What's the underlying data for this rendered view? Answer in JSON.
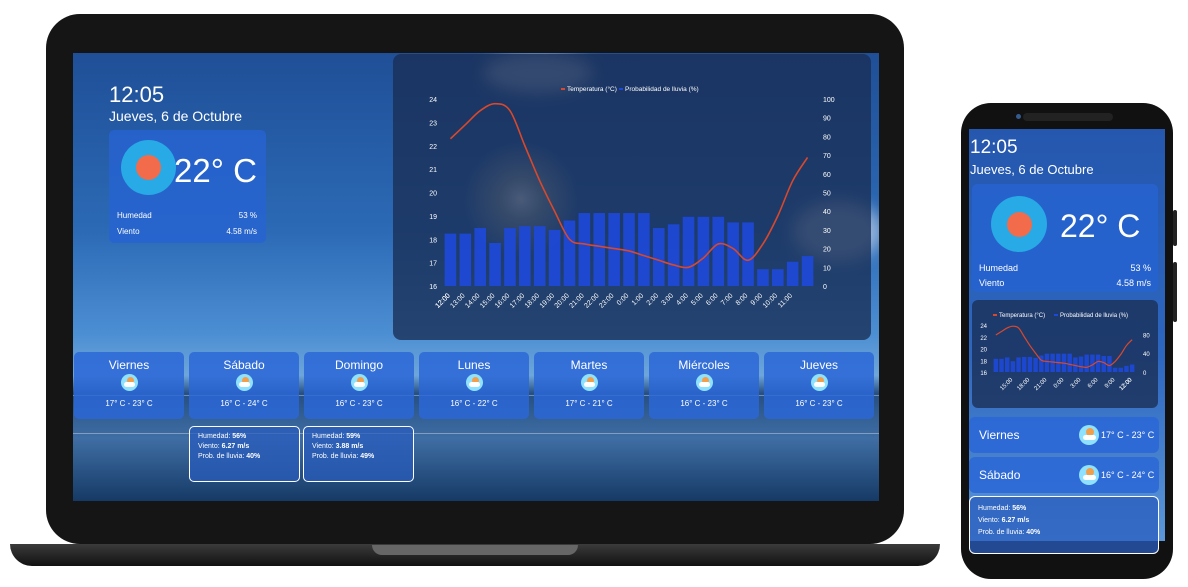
{
  "current": {
    "time": "12:05",
    "date": "Jueves, 6 de Octubre",
    "temperature": "22° C",
    "humidity_label": "Humedad",
    "humidity_value": "53 %",
    "wind_label": "Viento",
    "wind_value": "4.58 m/s"
  },
  "chart_data": {
    "type": "line",
    "legend": [
      "Temperatura (°C)",
      "Probabilidad de lluvia (%)"
    ],
    "legend_position": "top",
    "x": [
      "12:00",
      "13:00",
      "14:00",
      "15:00",
      "16:00",
      "17:00",
      "18:00",
      "19:00",
      "20:00",
      "21:00",
      "22:00",
      "23:00",
      "0:00",
      "1:00",
      "2:00",
      "3:00",
      "4:00",
      "5:00",
      "6:00",
      "7:00",
      "8:00",
      "9:00",
      "10:00",
      "11:00",
      "12:00"
    ],
    "series": [
      {
        "name": "Temperatura (°C)",
        "type": "line",
        "axis": "left",
        "color": "#d9482b",
        "values": [
          22.3,
          22.9,
          23.5,
          23.8,
          23.5,
          22.0,
          20.5,
          19.2,
          18.0,
          17.8,
          17.7,
          17.6,
          17.5,
          17.3,
          17.1,
          16.9,
          16.8,
          17.2,
          17.8,
          17.6,
          17.1,
          17.8,
          19.0,
          20.5,
          21.5
        ]
      },
      {
        "name": "Probabilidad de lluvia (%)",
        "type": "bar",
        "axis": "right",
        "color": "#1d49d8",
        "values": [
          28,
          28,
          31,
          23,
          31,
          32,
          32,
          30,
          35,
          39,
          39,
          39,
          39,
          39,
          31,
          33,
          37,
          37,
          37,
          34,
          34,
          9,
          9,
          13,
          16
        ]
      }
    ],
    "y_left": {
      "min": 16,
      "max": 24,
      "ticks": [
        16,
        17,
        18,
        19,
        20,
        21,
        22,
        23,
        24
      ]
    },
    "y_right": {
      "min": 0,
      "max": 100,
      "ticks": [
        0,
        10,
        20,
        30,
        40,
        50,
        60,
        70,
        80,
        90,
        100
      ]
    },
    "phone_x_ticks": [
      "12:00",
      "15:00",
      "18:00",
      "21:00",
      "0:00",
      "3:00",
      "6:00",
      "9:00",
      "12:00"
    ],
    "phone_y_left_ticks": [
      16,
      18,
      20,
      22,
      24
    ],
    "phone_y_right_ticks": [
      0,
      40,
      80
    ]
  },
  "forecast": [
    {
      "day": "Viernes",
      "range": "17° C - 23° C",
      "humidity": "",
      "wind": "",
      "rain": ""
    },
    {
      "day": "Sábado",
      "range": "16° C - 24° C",
      "humidity": "56%",
      "wind": "6.27 m/s",
      "rain": "40%"
    },
    {
      "day": "Domingo",
      "range": "16° C - 23° C",
      "humidity": "59%",
      "wind": "3.88 m/s",
      "rain": "49%"
    },
    {
      "day": "Lunes",
      "range": "16° C - 22° C"
    },
    {
      "day": "Martes",
      "range": "17° C - 21° C"
    },
    {
      "day": "Miércoles",
      "range": "16° C - 23° C"
    },
    {
      "day": "Jueves",
      "range": "16° C - 23° C"
    }
  ],
  "details_labels": {
    "humidity": "Humedad: ",
    "wind": "Viento: ",
    "rain": "Prob. de lluvia: "
  },
  "colors": {
    "card_blue": "#2b68d6",
    "sun_outer": "#27aae6",
    "sun_core": "#f26b4b",
    "temp_line": "#d9482b",
    "rain_bars": "#1d49d8"
  }
}
